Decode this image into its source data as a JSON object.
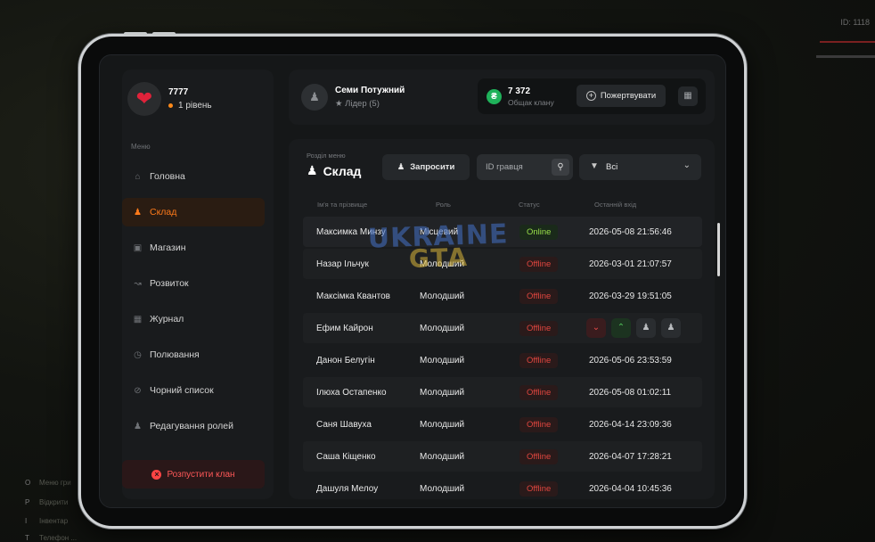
{
  "background": {
    "id_text": "ID: 1118",
    "hints": [
      {
        "key": "O",
        "text": "Меню гри"
      },
      {
        "key": "P",
        "text": "Відкрити"
      },
      {
        "key": "I",
        "text": "Інвентар"
      },
      {
        "key": "T",
        "text": "Телефон ..."
      }
    ]
  },
  "profile": {
    "avatar_icon": "heart-icon",
    "name": "7777",
    "level": "1 рівень"
  },
  "sidebar": {
    "menu_title": "Меню",
    "items": [
      {
        "label": "Головна",
        "icon": "home-icon",
        "active": false
      },
      {
        "label": "Склад",
        "icon": "group-icon",
        "active": true
      },
      {
        "label": "Магазин",
        "icon": "shop-icon",
        "active": false
      },
      {
        "label": "Розвиток",
        "icon": "chart-icon",
        "active": false
      },
      {
        "label": "Журнал",
        "icon": "book-icon",
        "active": false
      },
      {
        "label": "Полювання",
        "icon": "clock-icon",
        "active": false
      },
      {
        "label": "Чорний список",
        "icon": "block-icon",
        "active": false
      },
      {
        "label": "Редагування ролей",
        "icon": "user-edit-icon",
        "active": false
      }
    ],
    "disband_label": "Розпустити клан"
  },
  "header": {
    "family_name": "Семи Потужний",
    "family_role": "Лідер (5)",
    "money_value": "7 372",
    "money_label": "Общак клану",
    "donate_label": "Пожертвувати",
    "accent_color": "#ff7a1a",
    "coin_color": "#1fb25a"
  },
  "main": {
    "section_label": "Розділ меню",
    "section_title": "Склад",
    "invite_label": "Запросити",
    "search_placeholder": "ID гравця",
    "filter_value": "Всі",
    "columns": [
      "Ім'я та прізвище",
      "Роль",
      "Статус",
      "Останній вхід"
    ],
    "rows": [
      {
        "name": "Максимка Минзу",
        "role": "Місцевий",
        "status": "Online",
        "last": "2026-05-08 21:56:46"
      },
      {
        "name": "Назар Ільчук",
        "role": "Молодший",
        "status": "Offline",
        "last": "2026-03-01 21:07:57"
      },
      {
        "name": "Максімка Квантов",
        "role": "Молодший",
        "status": "Offline",
        "last": "2026-03-29 19:51:05"
      },
      {
        "name": "Ефим Кайрон",
        "role": "Молодший",
        "status": "Offline",
        "last": ""
      },
      {
        "name": "Данон Белугін",
        "role": "Молодший",
        "status": "Offline",
        "last": "2026-05-06 23:53:59"
      },
      {
        "name": "Ілюха Остапенко",
        "role": "Молодший",
        "status": "Offline",
        "last": "2026-05-08 01:02:11"
      },
      {
        "name": "Саня Шавуха",
        "role": "Молодший",
        "status": "Offline",
        "last": "2026-04-14 23:09:36"
      },
      {
        "name": "Саша Кіщенко",
        "role": "Молодший",
        "status": "Offline",
        "last": "2026-04-07 17:28:21"
      },
      {
        "name": "Дашуля Мелоу",
        "role": "Молодший",
        "status": "Offline",
        "last": "2026-04-04 10:45:36"
      }
    ],
    "online_color": "#9ae04a",
    "offline_color": "#e0463f"
  },
  "watermark": {
    "line1": "UKRAINE",
    "line2": "GTA"
  }
}
